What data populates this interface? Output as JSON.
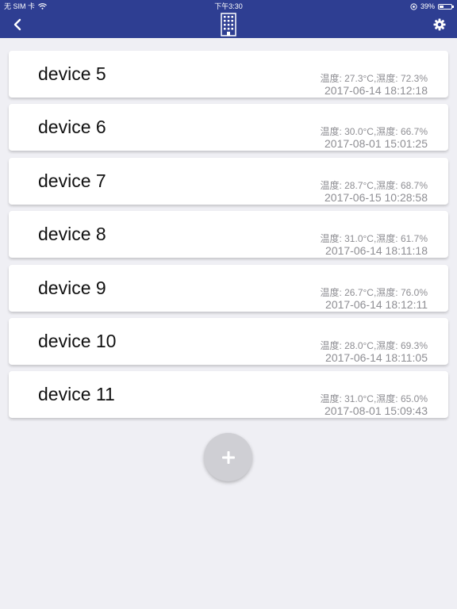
{
  "status_bar": {
    "carrier": "无 SIM 卡",
    "time": "下午3:30",
    "battery_percent": "39%",
    "battery_level": 0.39
  },
  "nav": {
    "back_icon": "chevron-left-icon",
    "logo_icon": "building-icon",
    "settings_icon": "gear-icon"
  },
  "devices": [
    {
      "name": "device 5",
      "reading": "温度: 27.3°C,濕度: 72.3%",
      "time": "2017-06-14 18:12:18"
    },
    {
      "name": "device 6",
      "reading": "温度: 30.0°C,濕度: 66.7%",
      "time": "2017-08-01 15:01:25"
    },
    {
      "name": "device 7",
      "reading": "温度: 28.7°C,濕度: 68.7%",
      "time": "2017-06-15 10:28:58"
    },
    {
      "name": "device 8",
      "reading": "温度: 31.0°C,濕度: 61.7%",
      "time": "2017-06-14 18:11:18"
    },
    {
      "name": "device 9",
      "reading": "温度: 26.7°C,濕度: 76.0%",
      "time": "2017-06-14 18:12:11"
    },
    {
      "name": "device 10",
      "reading": "温度: 28.0°C,濕度: 69.3%",
      "time": "2017-06-14 18:11:05"
    },
    {
      "name": "device 11",
      "reading": "温度: 31.0°C,濕度: 65.0%",
      "time": "2017-08-01 15:09:43"
    }
  ],
  "add_button": {
    "icon": "plus-icon"
  },
  "colors": {
    "nav_bar": "#2e3e92",
    "background": "#efeff4",
    "text_secondary": "#8e8e93"
  }
}
